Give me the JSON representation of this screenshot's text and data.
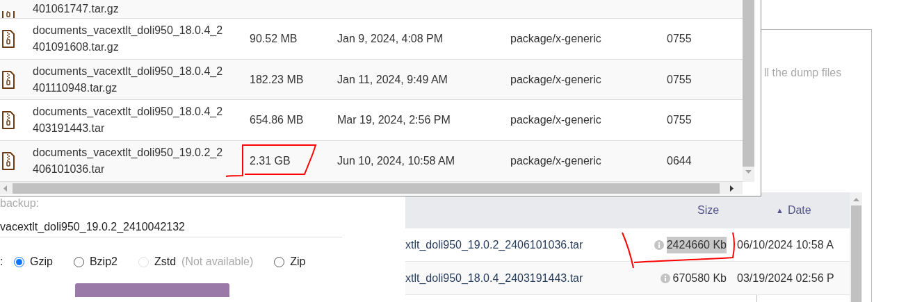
{
  "file_window": {
    "rows": [
      {
        "kind": "cut",
        "name_lines": [
          "401061747.tar.gz"
        ]
      },
      {
        "kind": "full",
        "name_lines": [
          "documents_vacextlt_doli950_18.0.4_2",
          "401091608.tar.gz"
        ],
        "size": "90.52 MB",
        "date": "Jan 9, 2024, 4:08 PM",
        "type": "package/x-generic",
        "permissions": "0755"
      },
      {
        "kind": "full",
        "name_lines": [
          "documents_vacextlt_doli950_18.0.4_2",
          "401110948.tar.gz"
        ],
        "size": "182.23 MB",
        "date": "Jan 11, 2024, 9:49 AM",
        "type": "package/x-generic",
        "permissions": "0755"
      },
      {
        "kind": "full",
        "name_lines": [
          "documents_vacextlt_doli950_18.0.4_2",
          "403191443.tar"
        ],
        "size": "654.86 MB",
        "date": "Mar 19, 2024, 2:56 PM",
        "type": "package/x-generic",
        "permissions": "0755"
      },
      {
        "kind": "full",
        "name_lines": [
          "documents_vacextlt_doli950_19.0.2_2",
          "406101036.tar"
        ],
        "size": "2.31 GB",
        "date": "Jun 10, 2024, 10:58 AM",
        "type": "package/x-generic",
        "permissions": "0644"
      }
    ]
  },
  "side_panel": {
    "text": "ll the dump files"
  },
  "backup_form": {
    "label": "backup:",
    "filename": "vacextlt_doli950_19.0.2_2410042132",
    "compression_label": ":",
    "options": [
      {
        "label": "Gzip",
        "selected": true,
        "disabled": false
      },
      {
        "label": "Bzip2",
        "selected": false,
        "disabled": false
      },
      {
        "label": "Zstd",
        "note": "(Not available)",
        "selected": false,
        "disabled": true
      },
      {
        "label": "Zip",
        "selected": false,
        "disabled": false
      }
    ]
  },
  "backup_table": {
    "columns": [
      "Size",
      "Date"
    ],
    "sort_indicator": "▲",
    "rows": [
      {
        "name": "xtlt_doli950_19.0.2_2406101036.tar",
        "size": "2424660 Kb",
        "date": "06/10/2024 10:58 A",
        "highlighted": true
      },
      {
        "name": "xtlt_doli950_18.0.4_2403191443.tar",
        "size": "670580 Kb",
        "date": "03/19/2024 02:56 P",
        "highlighted": false
      }
    ]
  }
}
